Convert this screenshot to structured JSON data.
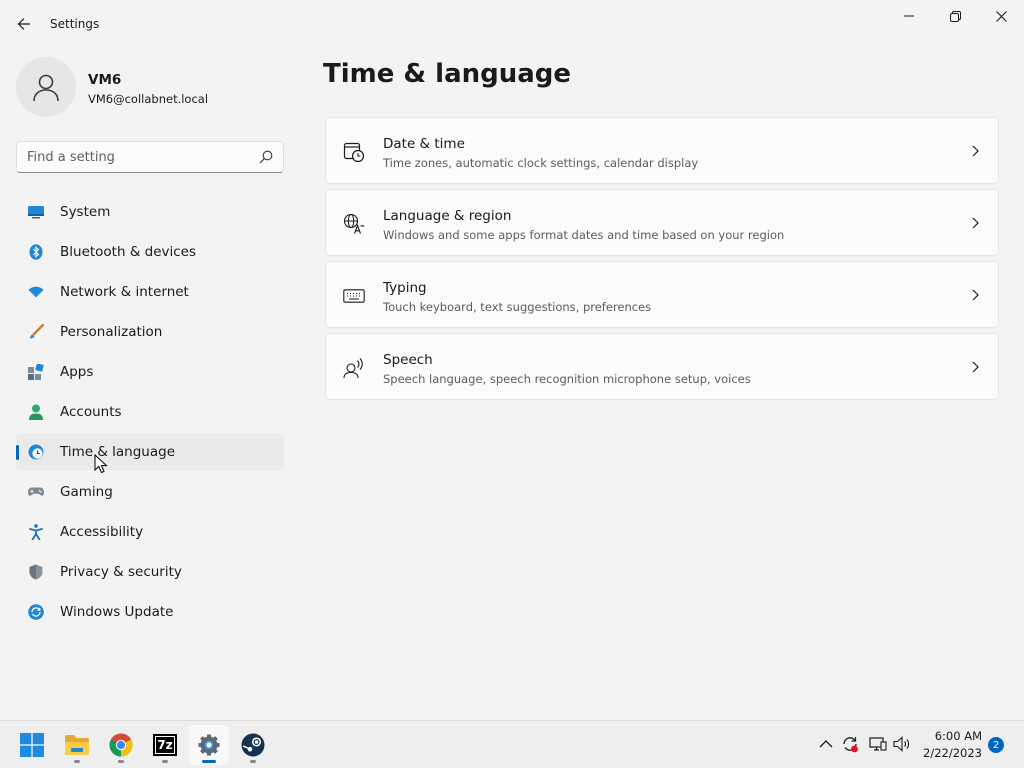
{
  "window": {
    "title": "Settings"
  },
  "profile": {
    "name": "VM6",
    "email": "VM6@collabnet.local"
  },
  "search": {
    "placeholder": "Find a setting",
    "value": ""
  },
  "sidebar": {
    "items": [
      {
        "label": "System",
        "icon": "system-icon",
        "selected": false
      },
      {
        "label": "Bluetooth & devices",
        "icon": "bluetooth-icon",
        "selected": false
      },
      {
        "label": "Network & internet",
        "icon": "wifi-icon",
        "selected": false
      },
      {
        "label": "Personalization",
        "icon": "brush-icon",
        "selected": false
      },
      {
        "label": "Apps",
        "icon": "apps-icon",
        "selected": false
      },
      {
        "label": "Accounts",
        "icon": "person-icon",
        "selected": false
      },
      {
        "label": "Time & language",
        "icon": "globe-clock-icon",
        "selected": true
      },
      {
        "label": "Gaming",
        "icon": "gamepad-icon",
        "selected": false
      },
      {
        "label": "Accessibility",
        "icon": "accessibility-icon",
        "selected": false
      },
      {
        "label": "Privacy & security",
        "icon": "shield-icon",
        "selected": false
      },
      {
        "label": "Windows Update",
        "icon": "update-icon",
        "selected": false
      }
    ]
  },
  "main": {
    "title": "Time & language",
    "cards": [
      {
        "title": "Date & time",
        "description": "Time zones, automatic clock settings, calendar display",
        "icon": "calendar-clock-icon"
      },
      {
        "title": "Language & region",
        "description": "Windows and some apps format dates and time based on your region",
        "icon": "language-icon"
      },
      {
        "title": "Typing",
        "description": "Touch keyboard, text suggestions, preferences",
        "icon": "keyboard-icon"
      },
      {
        "title": "Speech",
        "description": "Speech language, speech recognition microphone setup, voices",
        "icon": "speech-icon"
      }
    ]
  },
  "taskbar": {
    "apps": [
      {
        "name": "start-button",
        "icon": "windows-logo-icon"
      },
      {
        "name": "file-explorer",
        "icon": "folder-icon"
      },
      {
        "name": "chrome",
        "icon": "chrome-icon"
      },
      {
        "name": "7zip",
        "icon": "sevenzip-icon",
        "label": "7z"
      },
      {
        "name": "settings",
        "icon": "gear-icon"
      },
      {
        "name": "steam",
        "icon": "steam-icon"
      }
    ],
    "clock": {
      "time": "6:00 AM",
      "date": "2/22/2023"
    },
    "notifications": "2"
  },
  "colors": {
    "accent": "#0067c0",
    "background": "#f3f3f3",
    "card": "#fbfbfb"
  }
}
